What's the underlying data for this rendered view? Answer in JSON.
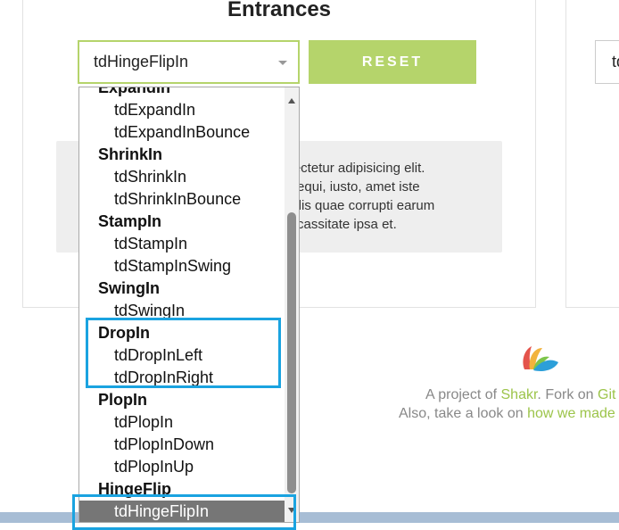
{
  "section_title": "Entrances",
  "select": {
    "value": "tdHingeFlipIn"
  },
  "reset_label": "RESET",
  "right_input_value": "td",
  "sample_text_lines": [
    "nsectetur adipisicing elit.",
    "n sequi, iusto, amet iste",
    "endis quae corrupti earum",
    "uplcassitate ipsa et."
  ],
  "footer": {
    "line1_prefix": "A project of ",
    "line1_link": "Shakr",
    "line1_mid": ". Fork on ",
    "line1_link2": "Git",
    "line2_prefix": "Also, take a look on ",
    "line2_link": "how we made"
  },
  "dropdown": {
    "items": [
      {
        "type": "group",
        "label": "ExpandIn"
      },
      {
        "type": "option",
        "label": "tdExpandIn"
      },
      {
        "type": "option",
        "label": "tdExpandInBounce"
      },
      {
        "type": "group",
        "label": "ShrinkIn"
      },
      {
        "type": "option",
        "label": "tdShrinkIn"
      },
      {
        "type": "option",
        "label": "tdShrinkInBounce"
      },
      {
        "type": "group",
        "label": "StampIn"
      },
      {
        "type": "option",
        "label": "tdStampIn"
      },
      {
        "type": "option",
        "label": "tdStampInSwing"
      },
      {
        "type": "group",
        "label": "SwingIn"
      },
      {
        "type": "option",
        "label": "tdSwingIn"
      },
      {
        "type": "group",
        "label": "DropIn"
      },
      {
        "type": "option",
        "label": "tdDropInLeft"
      },
      {
        "type": "option",
        "label": "tdDropInRight"
      },
      {
        "type": "group",
        "label": "PlopIn"
      },
      {
        "type": "option",
        "label": "tdPlopIn"
      },
      {
        "type": "option",
        "label": "tdPlopInDown"
      },
      {
        "type": "option",
        "label": "tdPlopInUp"
      },
      {
        "type": "group",
        "label": "HingeFlip"
      },
      {
        "type": "option",
        "label": "tdHingeFlipIn",
        "selected": true
      }
    ]
  },
  "colors": {
    "accent_green": "#b5d46b",
    "highlight_blue": "#1aa3e0",
    "selected_option_bg": "#767676"
  },
  "icons": {
    "logo": "shakr-logo-icon",
    "select_caret": "chevron-down-icon",
    "scroll_up": "scroll-up-arrow-icon",
    "scroll_down": "scroll-down-arrow-icon"
  }
}
